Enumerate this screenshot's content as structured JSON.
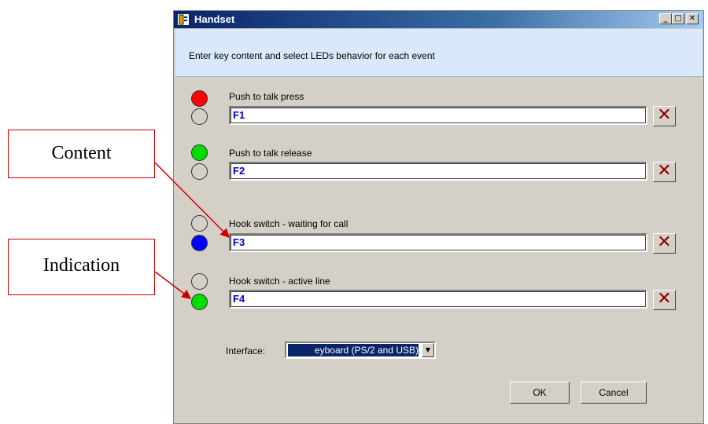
{
  "window": {
    "title": "Handset",
    "minimize": "_",
    "maximize": "□",
    "close": "✕",
    "instruction": "Enter key content and select LEDs behavior for each event"
  },
  "events": [
    {
      "label": "Push to talk press",
      "value": "F1",
      "led_top": "#ff0000",
      "led_bottom": "#d4d0c8"
    },
    {
      "label": "Push to talk release",
      "value": "F2",
      "led_top": "#00dd00",
      "led_bottom": "#d4d0c8"
    },
    {
      "label": "Hook switch - waiting for call",
      "value": "F3",
      "led_top": "#d4d0c8",
      "led_bottom": "#0000ff"
    },
    {
      "label": "Hook switch - active line",
      "value": "F4",
      "led_top": "#d4d0c8",
      "led_bottom": "#00dd00"
    }
  ],
  "delete_glyph": "✕",
  "interface": {
    "label": "Interface:",
    "selected": "eyboard (PS/2 and USB)",
    "arrow": "▼"
  },
  "buttons": {
    "ok": "OK",
    "cancel": "Cancel"
  },
  "callouts": {
    "content": "Content",
    "indication": "Indication"
  },
  "colors": {
    "accent": "#0a246a",
    "annotation": "#cc0000",
    "text_value": "#0000c8"
  }
}
